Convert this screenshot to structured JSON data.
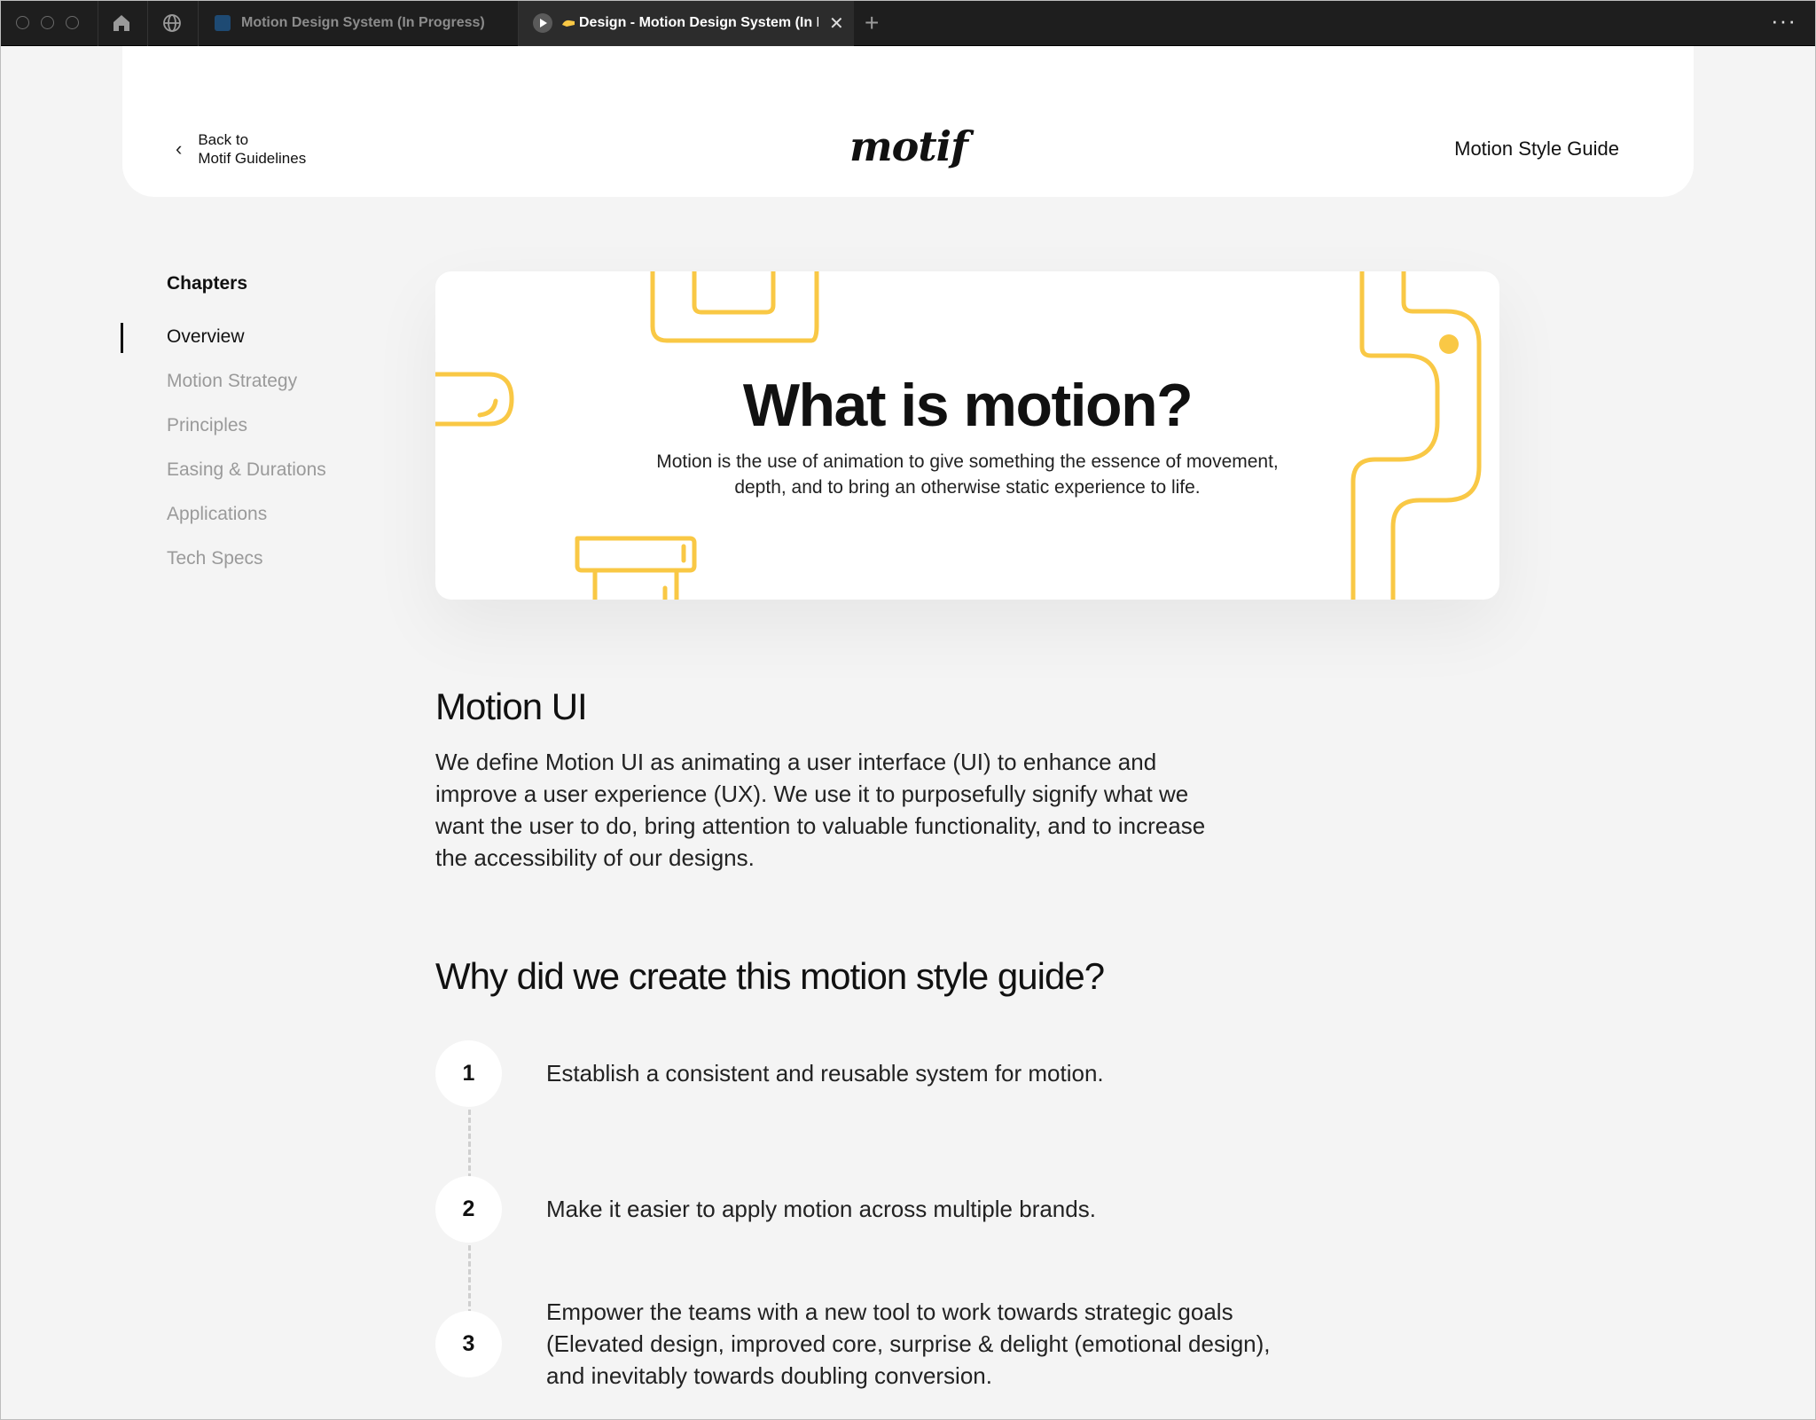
{
  "tabs": [
    {
      "label": "Motion Design System (In Progress)"
    },
    {
      "label": "Design - Motion Design System (In Progress)",
      "close": "✕"
    }
  ],
  "toolbar": {
    "new_tab": "+",
    "more": "···"
  },
  "header": {
    "back_line1": "Back to",
    "back_line2": "Motif Guidelines",
    "logo": "motif",
    "guide_title": "Motion Style Guide"
  },
  "sidebar": {
    "heading": "Chapters",
    "items": [
      {
        "label": "Overview",
        "active": true
      },
      {
        "label": "Motion Strategy"
      },
      {
        "label": "Principles"
      },
      {
        "label": "Easing & Durations"
      },
      {
        "label": "Applications"
      },
      {
        "label": "Tech Specs"
      }
    ]
  },
  "hero": {
    "title": "What is motion?",
    "subtitle_line1": "Motion is the use of animation to give something the essence of movement,",
    "subtitle_line2": "depth, and to bring an otherwise static experience to life.",
    "accent_color": "#F9C845"
  },
  "motion_ui": {
    "heading": "Motion UI",
    "body": "We define Motion UI as animating a user interface (UI) to enhance and improve a user experience (UX). We use it to purposefully signify what we want the user to do, bring attention to valuable functionality, and to increase the accessibility of our designs."
  },
  "why": {
    "heading": "Why did we create this motion style guide?",
    "steps": [
      {
        "num": "1",
        "text": "Establish a consistent and reusable system for motion."
      },
      {
        "num": "2",
        "text": "Make it easier to apply motion across multiple brands."
      },
      {
        "num": "3",
        "text": "Empower the teams with a new tool to work towards strategic goals (Elevated design, improved core, surprise & delight (emotional design), and inevitably towards doubling conversion."
      }
    ]
  }
}
